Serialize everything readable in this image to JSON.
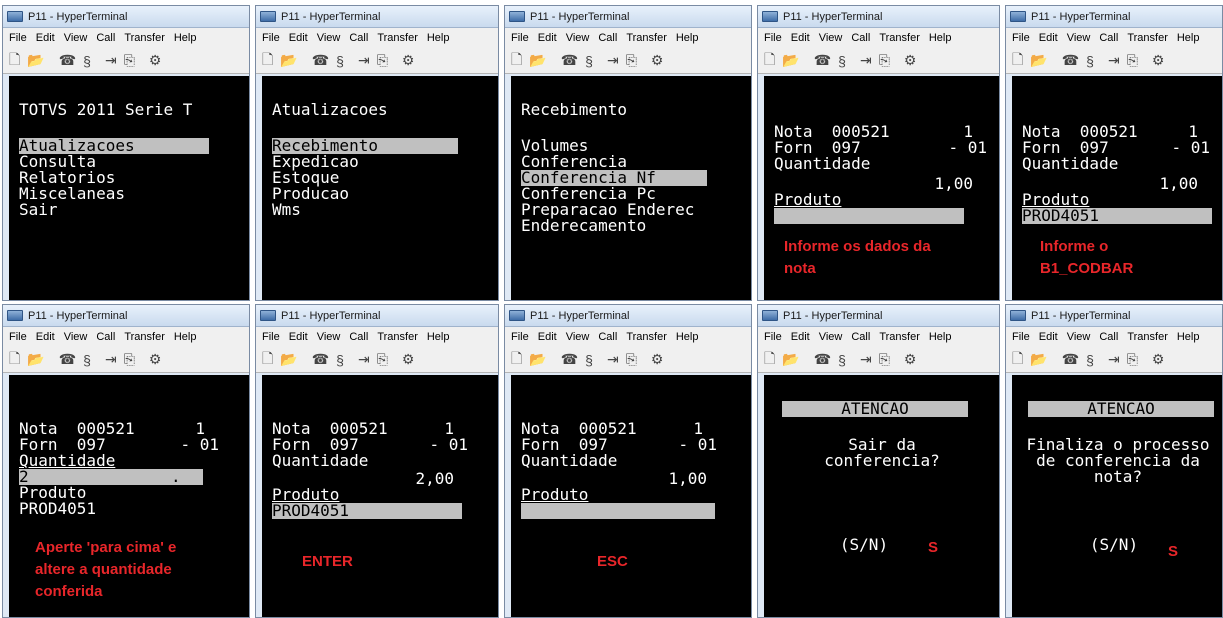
{
  "window_title": "P11 - HyperTerminal",
  "menu": [
    "File",
    "Edit",
    "View",
    "Call",
    "Transfer",
    "Help"
  ],
  "panels": [
    {
      "lines": [
        "TOTVS 2011 Serie T",
        "Atualizacoes",
        "Consulta",
        "Relatorios",
        "Miscelaneas",
        "Sair"
      ]
    },
    {
      "lines": [
        "Atualizacoes",
        "Recebimento",
        "Expedicao",
        "Estoque",
        "Producao",
        "Wms"
      ]
    },
    {
      "lines": [
        "Recebimento",
        "Volumes",
        "Conferencia",
        "Conferencia Nf",
        "Conferencia Pc",
        "Preparacao Enderec",
        "Enderecamento"
      ]
    },
    {
      "nota": "Nota  000521",
      "nota_num": "1",
      "forn": "Forn  097",
      "forn_num": "- 01",
      "qtd_label": "Quantidade",
      "qtd_value": "1,00",
      "prod_label": "Produto",
      "prod_value": "",
      "note": "Informe os dados da\nnota"
    },
    {
      "nota": "Nota  000521",
      "nota_num": "1",
      "forn": "Forn  097",
      "forn_num": "- 01",
      "qtd_label": "Quantidade",
      "qtd_value": "1,00",
      "prod_label": "Produto",
      "prod_value": "PROD4051_",
      "note": "Informe o\nB1_CODBAR"
    },
    {
      "nota": "Nota  000521",
      "nota_num": "1",
      "forn": "Forn  097",
      "forn_num": "- 01",
      "qtd_label": "Quantidade",
      "qtd_value": "2_",
      "qtd_dot": ".",
      "prod_label": "Produto",
      "prod_value": "PROD4051",
      "note": "Aperte 'para cima' e\naltere a quantidade\nconferida"
    },
    {
      "nota": "Nota  000521",
      "nota_num": "1",
      "forn": "Forn  097",
      "forn_num": "- 01",
      "qtd_label": "Quantidade",
      "qtd_value": "2,00",
      "prod_label": "Produto",
      "prod_value": "PROD4051",
      "note": "ENTER"
    },
    {
      "nota": "Nota  000521",
      "nota_num": "1",
      "forn": "Forn  097",
      "forn_num": "- 01",
      "qtd_label": "Quantidade",
      "qtd_value": "1,00",
      "prod_label": "Produto",
      "prod_value": "_",
      "note": "ESC"
    },
    {
      "header": "ATENCAO",
      "lines": [
        "Sair da",
        "conferencia?"
      ],
      "prompt": "(S/N)",
      "note": "S"
    },
    {
      "header": "ATENCAO",
      "lines": [
        "Finaliza o processo",
        "de conferencia da",
        "nota?"
      ],
      "prompt": "(S/N)",
      "note": "S"
    }
  ]
}
